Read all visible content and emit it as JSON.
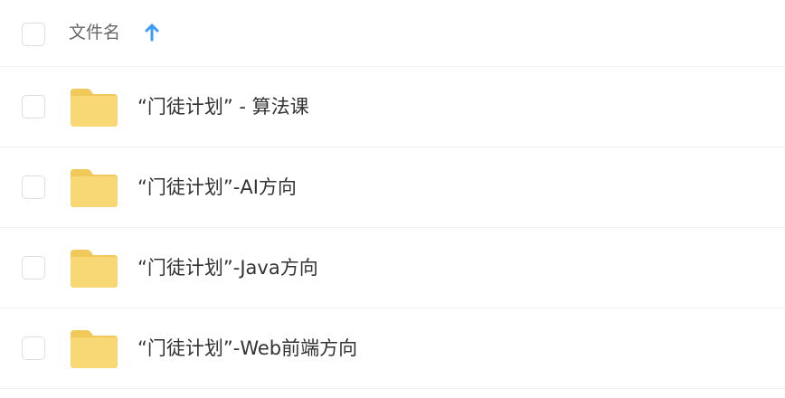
{
  "header": {
    "column_label": "文件名",
    "sort_icon": "arrow-up-icon"
  },
  "files": [
    {
      "name": "“门徒计划” - 算法课",
      "icon": "folder-icon"
    },
    {
      "name": "“门徒计划”-AI方向",
      "icon": "folder-icon"
    },
    {
      "name": "“门徒计划”-Java方向",
      "icon": "folder-icon"
    },
    {
      "name": "“门徒计划”-Web前端方向",
      "icon": "folder-icon"
    }
  ],
  "colors": {
    "folder": "#f8d775",
    "folder_tab": "#f1c95a",
    "sort_arrow": "#3b9cf5",
    "divider": "#f0f2f5"
  }
}
